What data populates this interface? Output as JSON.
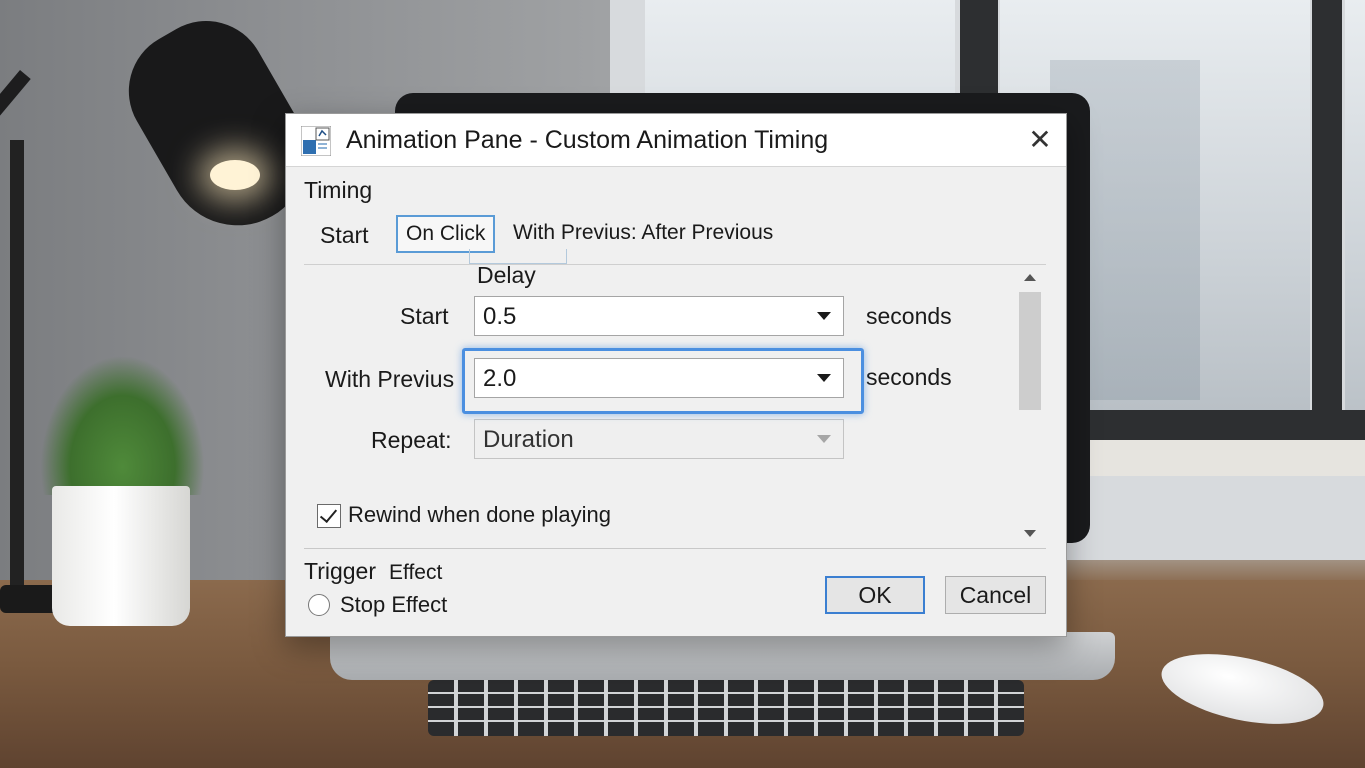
{
  "dialog": {
    "title": "Animation Pane - Custom Animation Timing",
    "close_label": "✕"
  },
  "timing": {
    "section_label": "Timing",
    "start_label": "Start",
    "tabs": [
      {
        "label": "On Click",
        "active": true
      },
      {
        "label": "With Previus: After Previous",
        "active": false
      }
    ]
  },
  "delay": {
    "heading": "Delay",
    "fields": [
      {
        "label": "Start",
        "value": "0.5",
        "unit": "seconds"
      },
      {
        "label": "With Previus",
        "value": "2.0",
        "unit": "seconds",
        "focused": true
      },
      {
        "label": "Repeat:",
        "value": "Duration",
        "disabled": true
      }
    ]
  },
  "rewind": {
    "label": "Rewind when done playing",
    "checked": true
  },
  "trigger": {
    "label": "Trigger",
    "effect_label": "Effect",
    "radio_label": "Stop Effect",
    "radio_selected": false
  },
  "buttons": {
    "ok": "OK",
    "cancel": "Cancel"
  },
  "colors": {
    "accent": "#4b8fe0",
    "dialog_bg": "#f0f0f0"
  }
}
